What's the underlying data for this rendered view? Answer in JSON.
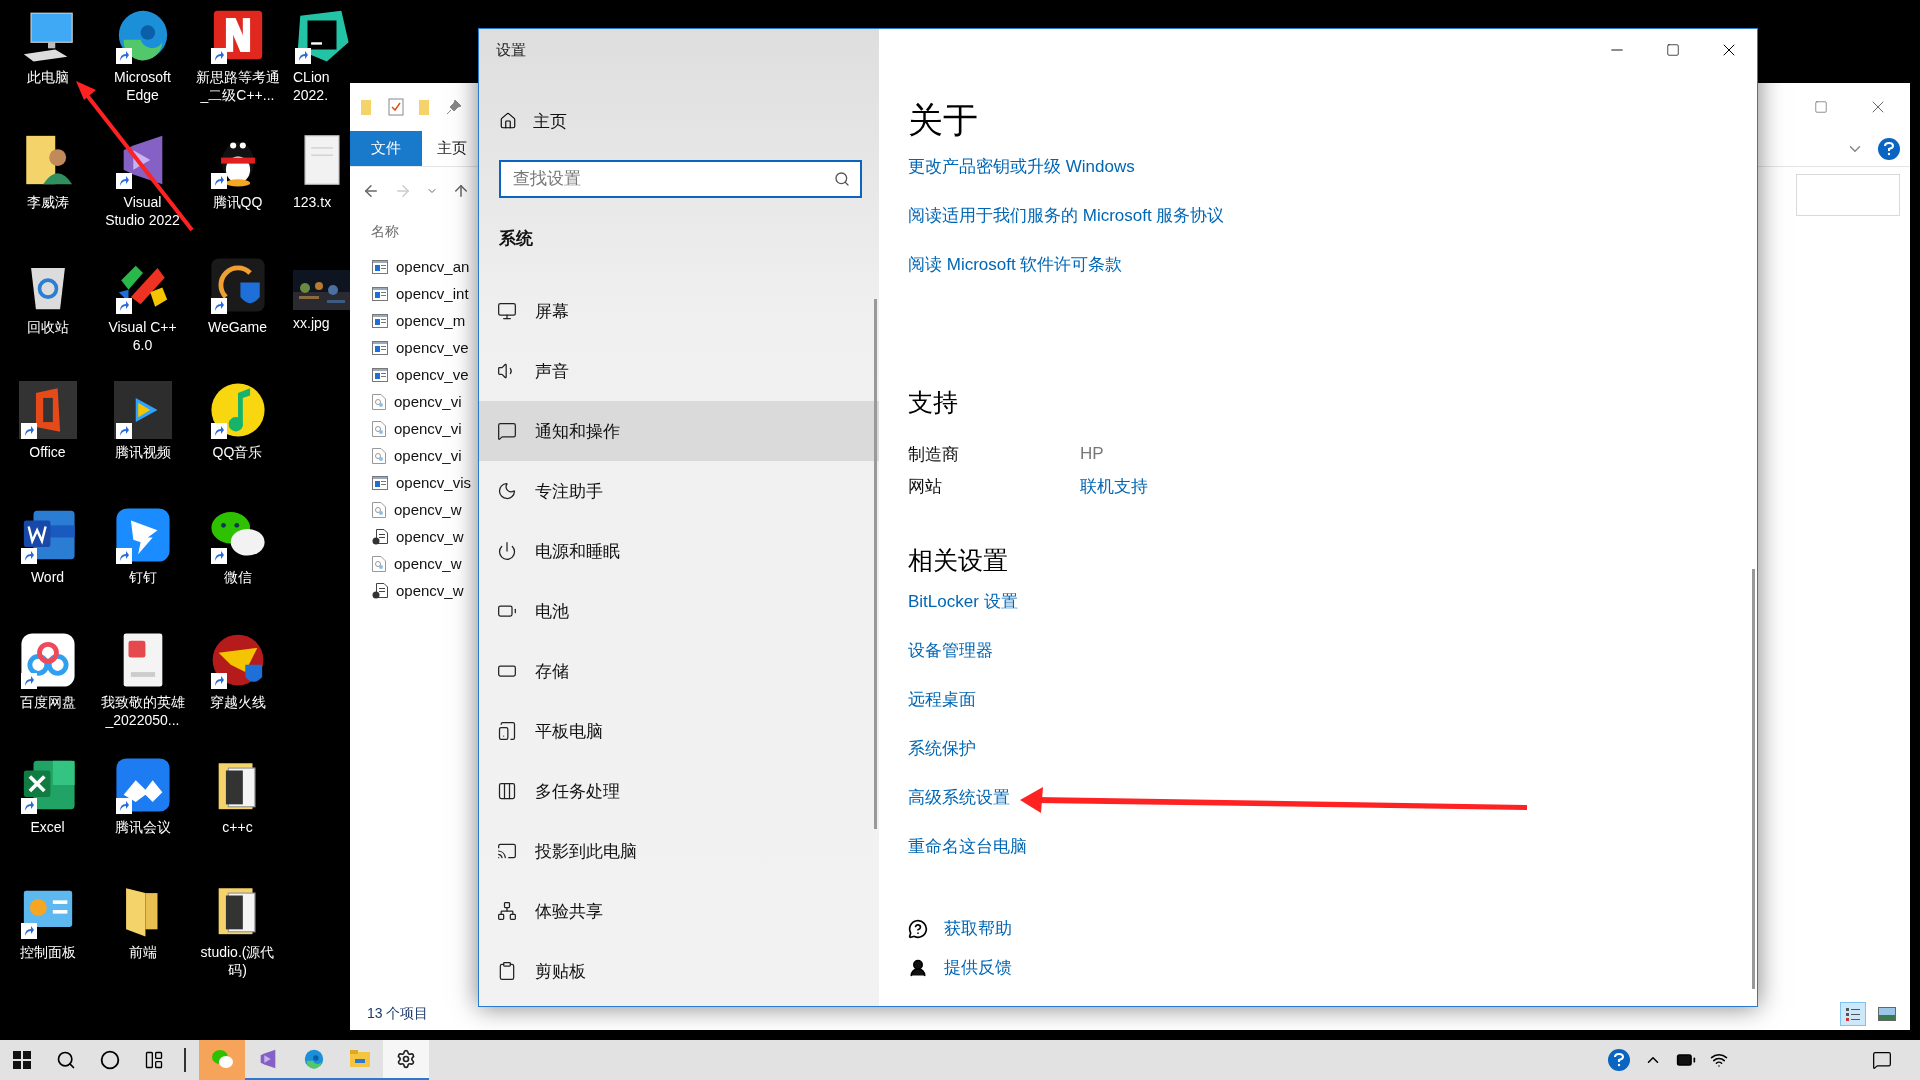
{
  "desktop": {
    "rows": [
      [
        {
          "label": [
            "此电脑"
          ],
          "kind": "pc",
          "shortcut": false
        },
        {
          "label": [
            "Microsoft",
            "Edge"
          ],
          "kind": "edge",
          "shortcut": true
        },
        {
          "label": [
            "新思路等考通",
            "_二级C++..."
          ],
          "kind": "n-app",
          "shortcut": true
        },
        {
          "label": [
            "CLion",
            "2022."
          ],
          "kind": "clion",
          "shortcut": true
        }
      ],
      [
        {
          "label": [
            "李威涛"
          ],
          "kind": "folder-user",
          "shortcut": false
        },
        {
          "label": [
            "Visual",
            "Studio 2022"
          ],
          "kind": "vs",
          "shortcut": true
        },
        {
          "label": [
            "腾讯QQ"
          ],
          "kind": "qq",
          "shortcut": true
        },
        {
          "label": [
            "123.tx"
          ],
          "kind": "textfile",
          "shortcut": false
        }
      ],
      [
        {
          "label": [
            "回收站"
          ],
          "kind": "recycle",
          "shortcut": false
        },
        {
          "label": [
            "Visual C++",
            "6.0"
          ],
          "kind": "vcpp",
          "shortcut": true
        },
        {
          "label": [
            "WeGame"
          ],
          "kind": "wegame",
          "shortcut": true
        },
        {
          "label": [
            "xx.jpg"
          ],
          "shortcut": false
        }
      ],
      [
        {
          "label": [
            "Office"
          ],
          "kind": "office",
          "shortcut": true
        },
        {
          "label": [
            "腾讯视频"
          ],
          "kind": "video",
          "shortcut": true
        },
        {
          "label": [
            "QQ音乐"
          ],
          "kind": "music",
          "shortcut": true
        }
      ],
      [
        {
          "label": [
            "Word"
          ],
          "kind": "word",
          "shortcut": true
        },
        {
          "label": [
            "钉钉"
          ],
          "kind": "dingtalk",
          "shortcut": true
        },
        {
          "label": [
            "微信"
          ],
          "kind": "wechat",
          "shortcut": true
        }
      ],
      [
        {
          "label": [
            "百度网盘"
          ],
          "kind": "baidu",
          "shortcut": true
        },
        {
          "label": [
            "我致敬的英雄",
            "_2022050..."
          ],
          "kind": "pdf",
          "shortcut": false
        },
        {
          "label": [
            "穿越火线"
          ],
          "kind": "cf",
          "shortcut": true
        }
      ],
      [
        {
          "label": [
            "Excel"
          ],
          "kind": "excel",
          "shortcut": true
        },
        {
          "label": [
            "腾讯会议"
          ],
          "kind": "meeting",
          "shortcut": true
        },
        {
          "label": [
            "c++c"
          ],
          "kind": "folder-doc",
          "shortcut": false
        }
      ],
      [
        {
          "label": [
            "控制面板"
          ],
          "kind": "control",
          "shortcut": true
        },
        {
          "label": [
            "前端"
          ],
          "kind": "folder",
          "shortcut": false
        },
        {
          "label": [
            "studio.(源代",
            "码)"
          ],
          "kind": "folder-doc",
          "shortcut": false
        }
      ]
    ]
  },
  "explorer": {
    "tabs": [
      {
        "label": "文件",
        "kind": "file"
      },
      {
        "label": "主页",
        "kind": "tab"
      }
    ],
    "column": "名称",
    "files": [
      {
        "name": "opencv_an",
        "kind": "app"
      },
      {
        "name": "opencv_int",
        "kind": "app"
      },
      {
        "name": "opencv_m",
        "kind": "app"
      },
      {
        "name": "opencv_ve",
        "kind": "app"
      },
      {
        "name": "opencv_ve",
        "kind": "app"
      },
      {
        "name": "opencv_vi",
        "kind": "config"
      },
      {
        "name": "opencv_vi",
        "kind": "config"
      },
      {
        "name": "opencv_vi",
        "kind": "config"
      },
      {
        "name": "opencv_vis",
        "kind": "app"
      },
      {
        "name": "opencv_w",
        "kind": "config"
      },
      {
        "name": "opencv_w",
        "kind": "script"
      },
      {
        "name": "opencv_w",
        "kind": "config"
      },
      {
        "name": "opencv_w",
        "kind": "script"
      }
    ],
    "status": "13 个项目"
  },
  "settings": {
    "title": "设置",
    "home": "主页",
    "search": {
      "placeholder": "查找设置"
    },
    "section": "系统",
    "nav": [
      {
        "label": "屏幕",
        "kind": "display",
        "selected": false
      },
      {
        "label": "声音",
        "kind": "sound",
        "selected": false
      },
      {
        "label": "通知和操作",
        "kind": "notification",
        "selected": true
      },
      {
        "label": "专注助手",
        "kind": "focus",
        "selected": false
      },
      {
        "label": "电源和睡眠",
        "kind": "power",
        "selected": false
      },
      {
        "label": "电池",
        "kind": "battery",
        "selected": false
      },
      {
        "label": "存储",
        "kind": "storage",
        "selected": false
      },
      {
        "label": "平板电脑",
        "kind": "tablet",
        "selected": false
      },
      {
        "label": "多任务处理",
        "kind": "multitask",
        "selected": false
      },
      {
        "label": "投影到此电脑",
        "kind": "project",
        "selected": false
      },
      {
        "label": "体验共享",
        "kind": "share",
        "selected": false
      },
      {
        "label": "剪贴板",
        "kind": "clipboard",
        "selected": false
      }
    ],
    "content": {
      "heading": "关于",
      "links": [
        "更改产品密钥或升级 Windows",
        "阅读适用于我们服务的 Microsoft 服务协议",
        "阅读 Microsoft 软件许可条款"
      ],
      "support": {
        "heading": "支持",
        "rows": [
          {
            "label": "制造商",
            "value": "HP",
            "kind": "text"
          },
          {
            "label": "网站",
            "value": "联机支持",
            "kind": "link"
          }
        ]
      },
      "related": {
        "heading": "相关设置",
        "links": [
          "BitLocker 设置",
          "设备管理器",
          "远程桌面",
          "系统保护",
          "高级系统设置",
          "重命名这台电脑"
        ]
      },
      "help": [
        {
          "label": "获取帮助",
          "kind": "help"
        },
        {
          "label": "提供反馈",
          "kind": "feedback"
        }
      ]
    }
  },
  "taskbar": {
    "apps": [
      {
        "kind": "wechat",
        "flashing": true,
        "selected": false
      },
      {
        "kind": "vs",
        "flashing": false,
        "selected": false
      },
      {
        "kind": "edge",
        "flashing": false,
        "selected": false
      },
      {
        "kind": "explorer",
        "flashing": false,
        "selected": false
      },
      {
        "kind": "settings",
        "flashing": false,
        "selected": true
      }
    ]
  }
}
